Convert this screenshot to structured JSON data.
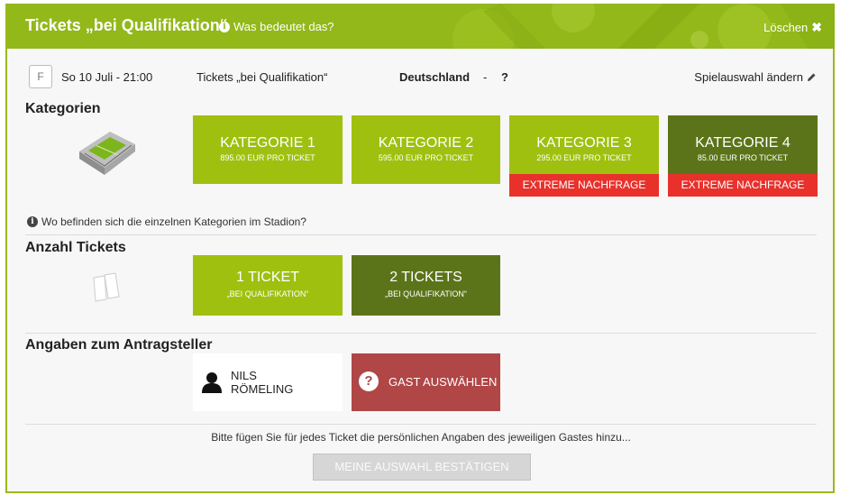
{
  "header": {
    "title": "Tickets „bei Qualifikation“",
    "info_link": "Was bedeutet das?",
    "delete_label": "Löschen"
  },
  "match": {
    "group": "F",
    "date": "So 10 Juli - 21:00",
    "ticket_type": "Tickets „bei Qualifikation“",
    "team": "Deutschland",
    "separator": "-",
    "opponent": "?",
    "change_label": "Spielauswahl ändern"
  },
  "categories": {
    "title": "Kategorien",
    "items": [
      {
        "label": "KATEGORIE 1",
        "price": "895.00 EUR PRO TICKET",
        "badge": ""
      },
      {
        "label": "KATEGORIE 2",
        "price": "595.00 EUR PRO TICKET",
        "badge": ""
      },
      {
        "label": "KATEGORIE 3",
        "price": "295.00 EUR PRO TICKET",
        "badge": "EXTREME NACHFRAGE"
      },
      {
        "label": "KATEGORIE 4",
        "price": "85.00 EUR PRO TICKET",
        "badge": "EXTREME NACHFRAGE"
      }
    ],
    "stadium_hint": "Wo befinden sich die einzelnen Kategorien im Stadion?"
  },
  "tickets": {
    "title": "Anzahl Tickets",
    "items": [
      {
        "label": "1 TICKET",
        "sub": "„BEI QUALIFIKATION“"
      },
      {
        "label": "2 TICKETS",
        "sub": "„BEI QUALIFIKATION“"
      }
    ]
  },
  "applicant": {
    "title": "Angaben zum Antragsteller",
    "name_line1": "NILS",
    "name_line2": "RÖMELING",
    "guest_label": "GAST AUSWÄHLEN"
  },
  "footer": {
    "note": "Bitte fügen Sie für jedes Ticket die persönlichen Angaben des jeweiligen Gastes hinzu...",
    "confirm_label": "MEINE AUSWAHL BESTÄTIGEN"
  },
  "colors": {
    "header_green": "#92b81a",
    "light_green": "#a0c010",
    "dark_green": "#5c7419",
    "alert_red": "#e8312b",
    "guest_red": "#b04646"
  }
}
